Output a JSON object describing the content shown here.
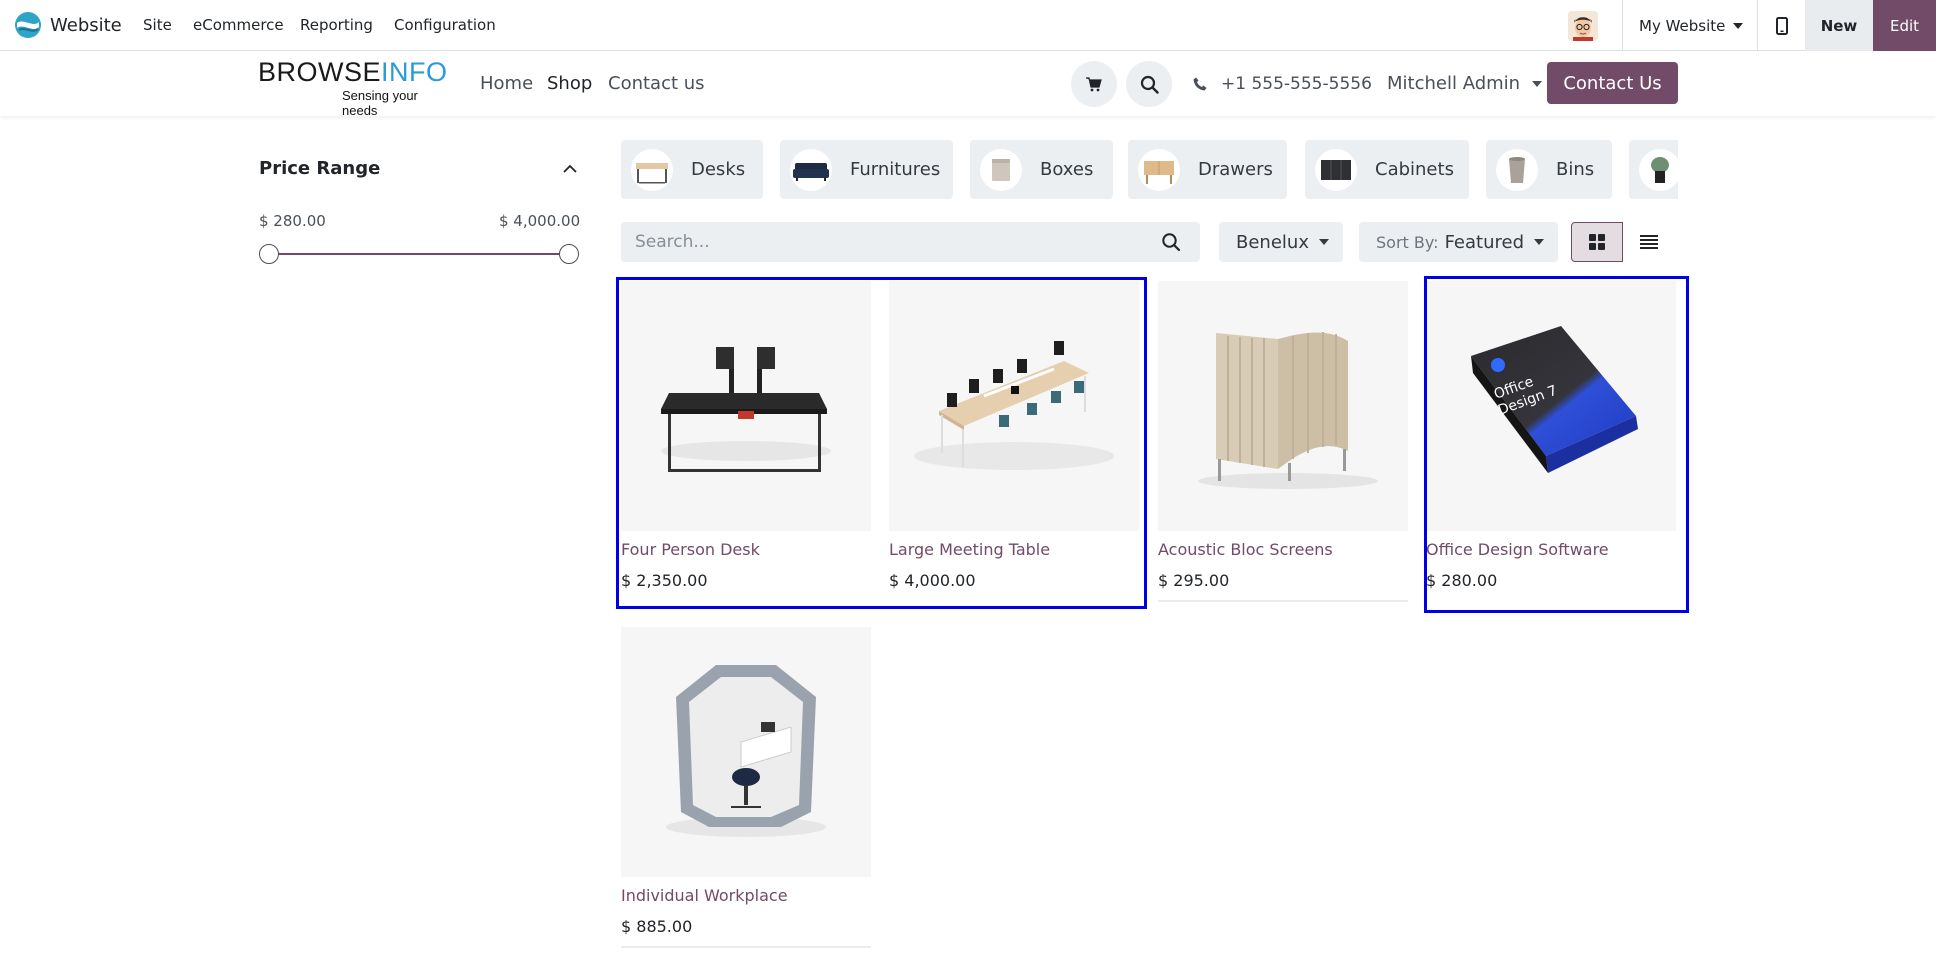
{
  "admin_bar": {
    "app_name": "Website",
    "menu": [
      "Site",
      "eCommerce",
      "Reporting",
      "Configuration"
    ],
    "website_selector": "My Website",
    "new_label": "New",
    "edit_label": "Edit",
    "accent_color": "#714b67"
  },
  "header": {
    "logo_word_1": "BROWSE",
    "logo_word_2": "INFO",
    "logo_tagline": "Sensing your needs",
    "nav": [
      "Home",
      "Shop",
      "Contact us"
    ],
    "active_nav": "Shop",
    "phone": "+1 555-555-5556",
    "user": "Mitchell Admin",
    "contact_button": "Contact Us"
  },
  "sidebar": {
    "title": "Price Range",
    "min_label": "$ 280.00",
    "max_label": "$ 4,000.00",
    "slider_low_fraction": 0.0,
    "slider_high_fraction": 1.0
  },
  "categories": [
    {
      "label": "Desks",
      "icon": "desk-thumbnail"
    },
    {
      "label": "Furnitures",
      "icon": "sofa-thumbnail"
    },
    {
      "label": "Boxes",
      "icon": "box-thumbnail"
    },
    {
      "label": "Drawers",
      "icon": "drawer-thumbnail"
    },
    {
      "label": "Cabinets",
      "icon": "cabinet-thumbnail"
    },
    {
      "label": "Bins",
      "icon": "bin-thumbnail"
    },
    {
      "label": "",
      "icon": "lamp-thumbnail"
    }
  ],
  "filters": {
    "search_placeholder": "Search...",
    "pricelist": "Benelux",
    "sort_prefix": "Sort By:",
    "sort_value": "Featured"
  },
  "products": [
    {
      "name": "Four Person Desk",
      "price": "$ 2,350.00"
    },
    {
      "name": "Large Meeting Table",
      "price": "$ 4,000.00"
    },
    {
      "name": "Acoustic Bloc Screens",
      "price": "$ 295.00"
    },
    {
      "name": "Office Design Software",
      "price": "$ 280.00",
      "box_text": "Office Design 7"
    },
    {
      "name": "Individual Workplace",
      "price": "$ 885.00"
    }
  ]
}
